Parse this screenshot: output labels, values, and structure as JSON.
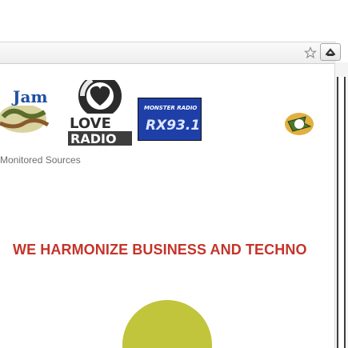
{
  "logos": {
    "jam": {
      "text": "Jam"
    },
    "love": {
      "line1": "LOVE",
      "line2": "RADIO"
    },
    "monster": {
      "text": "MONSTER RADIO",
      "sub": "RX93.1"
    }
  },
  "sources_label": "Monitored Sources",
  "headline": "WE HARMONIZE BUSINESS AND TECHNO",
  "colors": {
    "headline": "#c4342a",
    "blob": "#c0c53c",
    "love_bg": "#3d3d3d",
    "monster_bg": "#1f3fa8"
  },
  "icons": {
    "star": "star-outline-icon",
    "extension": "extension-icon"
  }
}
